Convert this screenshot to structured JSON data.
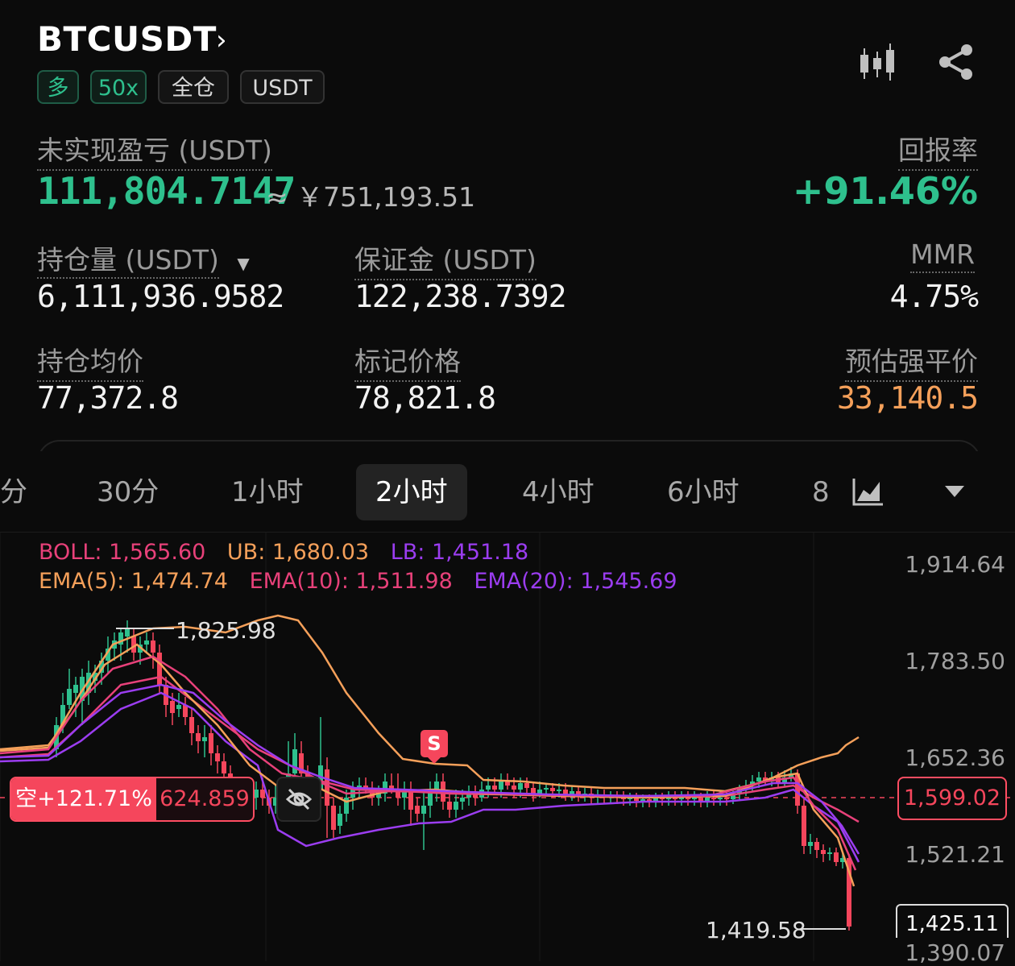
{
  "header": {
    "symbol": "BTCUSDT",
    "tags": [
      "多",
      "50x",
      "全仓",
      "USDT"
    ]
  },
  "pnl": {
    "label": "未实现盈亏 (USDT)",
    "value": "111,804.7147",
    "cny": "≈ ￥751,193.51",
    "return_label": "回报率",
    "return_value": "+91.46%"
  },
  "stats": {
    "position_label": "持仓量 (USDT)",
    "position_value": "6,111,936.9582",
    "margin_label": "保证金 (USDT)",
    "margin_value": "122,238.7392",
    "mmr_label": "MMR",
    "mmr_value": "4.75%",
    "avg_label": "持仓均价",
    "avg_value": "77,372.8",
    "mark_label": "标记价格",
    "mark_value": "78,821.8",
    "liq_label": "预估强平价",
    "liq_value": "33,140.5"
  },
  "tabs": [
    "分",
    "30分",
    "1小时",
    "2小时",
    "4小时",
    "6小时",
    "8"
  ],
  "active_tab": "2小时",
  "chart": {
    "legend_line1": [
      {
        "text": "BOLL: 1,565.60",
        "color": "#e8417a"
      },
      {
        "text": "UB: 1,680.03",
        "color": "#f5a05a"
      },
      {
        "text": "LB: 1,451.18",
        "color": "#9b3df0"
      }
    ],
    "legend_line2": [
      {
        "text": "EMA(5): 1,474.74",
        "color": "#f5a05a"
      },
      {
        "text": "EMA(10): 1,511.98",
        "color": "#e8417a"
      },
      {
        "text": "EMA(20): 1,545.69",
        "color": "#9b3df0"
      }
    ],
    "y_labels": [
      "1,914.64",
      "1,783.50",
      "1,652.36",
      "1,521.21",
      "1,390.07"
    ],
    "high_label": "1,825.98",
    "low_label": "1,419.58",
    "current_price": "1,599.02",
    "bottom_partial": "1,425.11",
    "signal": "S",
    "short_badge": {
      "left": "空+121.71%",
      "right": "624.859"
    }
  },
  "colors": {
    "up": "#2ec08d",
    "down": "#f5465c",
    "orange": "#f5a05a",
    "pink": "#e8417a",
    "purple": "#9b3df0"
  }
}
